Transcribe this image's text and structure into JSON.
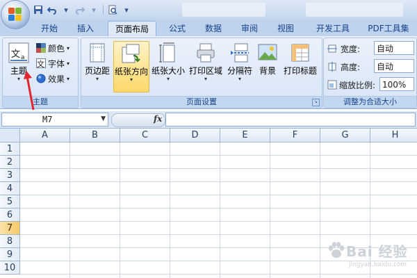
{
  "quick_access": {
    "save_icon": "save-icon",
    "undo_icon": "undo-icon",
    "redo_icon": "redo-icon",
    "print_preview_icon": "print-preview-icon",
    "customize_icon": "customize-dropdown-icon"
  },
  "ribbon": {
    "tabs": [
      {
        "label": "开始"
      },
      {
        "label": "插入"
      },
      {
        "label": "页面布局",
        "active": true
      },
      {
        "label": "公式"
      },
      {
        "label": "数据"
      },
      {
        "label": "审阅"
      },
      {
        "label": "视图"
      },
      {
        "label": "开发工具"
      },
      {
        "label": "PDF工具集"
      }
    ],
    "themes_group": {
      "label": "主题",
      "theme_button": "主题",
      "colors": "颜色",
      "fonts": "字体",
      "effects": "效果"
    },
    "page_setup_group": {
      "label": "页面设置",
      "margins": "页边距",
      "orientation": "纸张方向",
      "size": "纸张大小",
      "print_area": "打印区域",
      "breaks": "分隔符",
      "background": "背景",
      "print_titles": "打印标题"
    },
    "scale_group": {
      "label": "调整为合适大小",
      "width_label": "宽度:",
      "width_value": "自动",
      "height_label": "高度:",
      "height_value": "自动",
      "scale_label": "缩放比例:",
      "scale_value": "100%"
    }
  },
  "formula_bar": {
    "name_box": "M7",
    "fx_label": "fx",
    "formula": ""
  },
  "sheet": {
    "columns": [
      "A",
      "B",
      "C",
      "D",
      "E",
      "F",
      "G",
      "H"
    ],
    "rows": [
      "1",
      "2",
      "3",
      "4",
      "5",
      "6",
      "7",
      "8",
      "9",
      "10"
    ],
    "selected_row": "7"
  },
  "watermark": {
    "main": "Bai 经验",
    "sub": "jingyan.baidu.com"
  },
  "colors": {
    "ribbon_bg": "#dfe9f6",
    "hot_button": "#ffd869",
    "arrow": "#e0262b",
    "grid_line": "#d0d7e5"
  }
}
